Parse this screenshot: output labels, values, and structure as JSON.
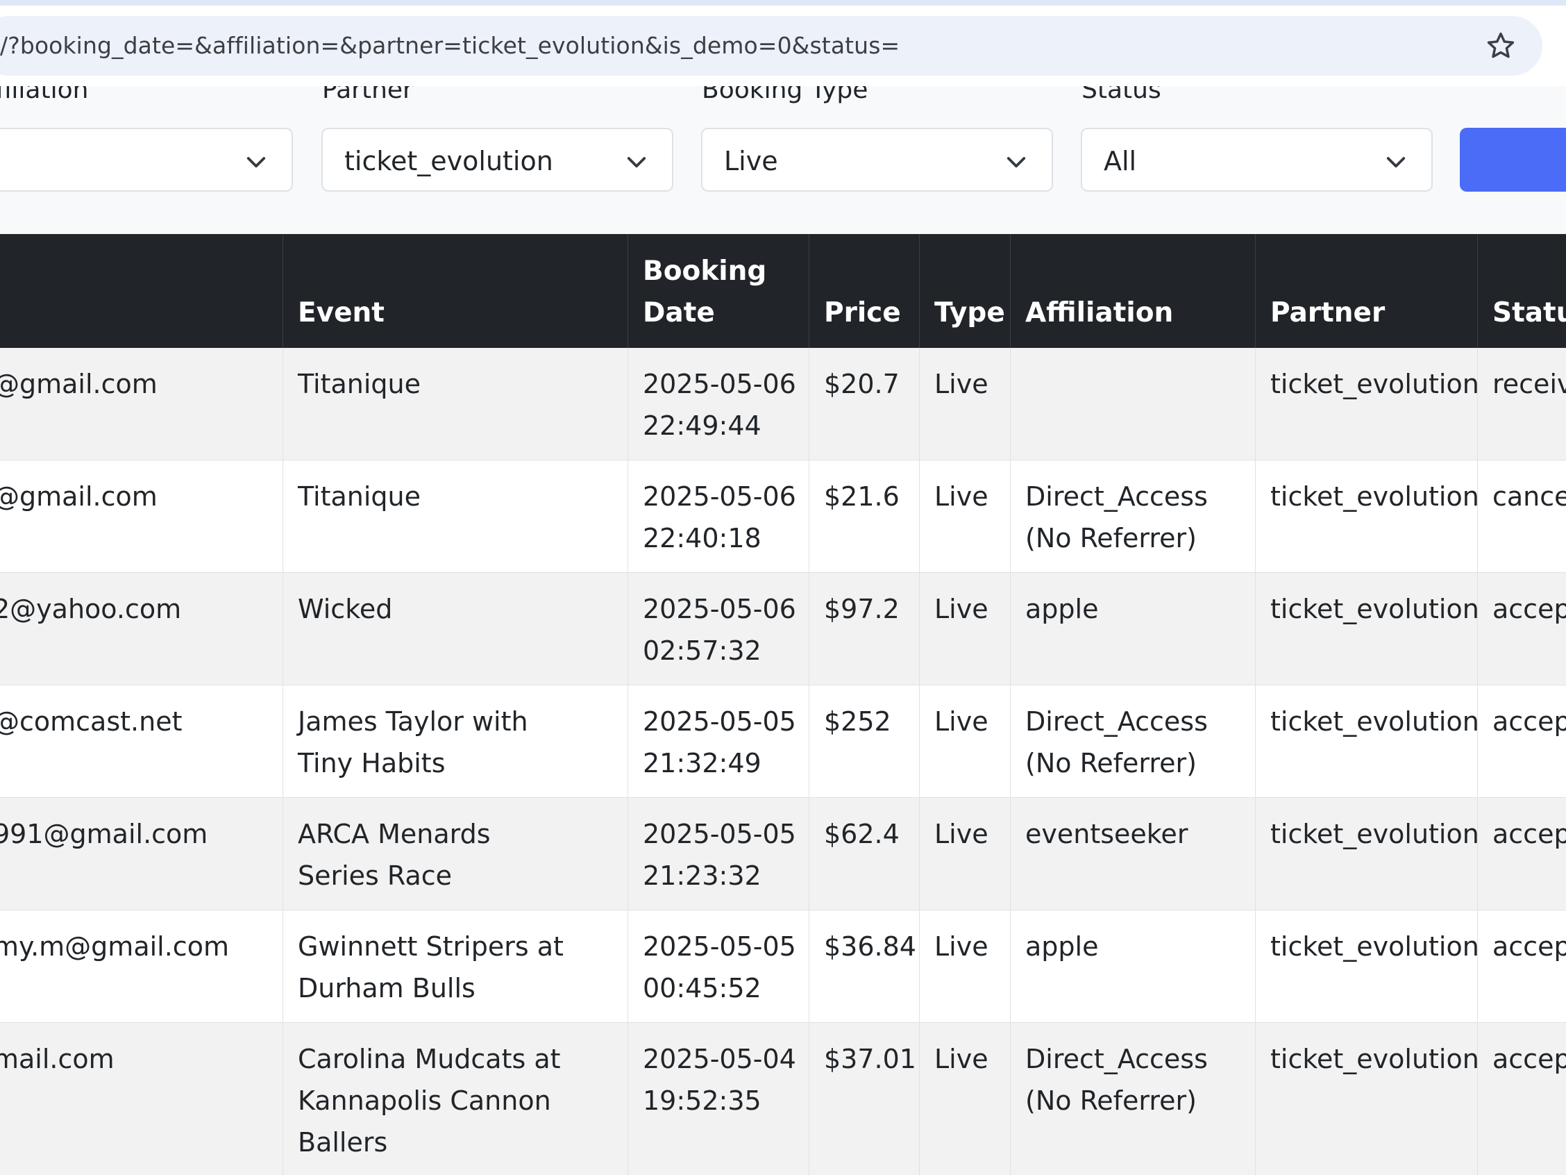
{
  "browser": {
    "url": "/?booking_date=&affiliation=&partner=ticket_evolution&is_demo=0&status="
  },
  "filters": {
    "affiliation_label": "Affiliation",
    "affiliation_value": "",
    "partner_label": "Partner",
    "partner_value": "ticket_evolution",
    "booking_type_label": "Booking Type",
    "booking_type_value": "Live",
    "status_label": "Status",
    "status_value": "All"
  },
  "table": {
    "headers": {
      "email": "",
      "event": "Event",
      "booking_date": "Booking Date",
      "price": "Price",
      "type": "Type",
      "affiliation": "Affiliation",
      "partner": "Partner",
      "status": "Status"
    },
    "rows": [
      {
        "email": "@gmail.com",
        "event": "Titanique",
        "date": "2025-05-06",
        "time": "22:49:44",
        "price": "$20.7",
        "type": "Live",
        "affiliation": "",
        "partner": "ticket_evolution",
        "status": "received"
      },
      {
        "email": "@gmail.com",
        "event": "Titanique",
        "date": "2025-05-06",
        "time": "22:40:18",
        "price": "$21.6",
        "type": "Live",
        "affiliation": "Direct_Access (No Referrer)",
        "partner": "ticket_evolution",
        "status": "cancelled"
      },
      {
        "email": "2@yahoo.com",
        "event": "Wicked",
        "date": "2025-05-06",
        "time": "02:57:32",
        "price": "$97.2",
        "type": "Live",
        "affiliation": "apple",
        "partner": "ticket_evolution",
        "status": "accepted"
      },
      {
        "email": "@comcast.net",
        "event": "James Taylor with Tiny Habits",
        "date": "2025-05-05",
        "time": "21:32:49",
        "price": "$252",
        "type": "Live",
        "affiliation": "Direct_Access (No Referrer)",
        "partner": "ticket_evolution",
        "status": "accepted"
      },
      {
        "email": "991@gmail.com",
        "event": "ARCA Menards Series Race",
        "date": "2025-05-05",
        "time": "21:23:32",
        "price": "$62.4",
        "type": "Live",
        "affiliation": "eventseeker",
        "partner": "ticket_evolution",
        "status": "accepted"
      },
      {
        "email": "my.m@gmail.com",
        "event": "Gwinnett Stripers at Durham Bulls",
        "date": "2025-05-05",
        "time": "00:45:52",
        "price": "$36.84",
        "type": "Live",
        "affiliation": "apple",
        "partner": "ticket_evolution",
        "status": "accepted"
      },
      {
        "email": "mail.com",
        "event": "Carolina Mudcats at Kannapolis Cannon Ballers",
        "date": "2025-05-04",
        "time": "19:52:35",
        "price": "$37.01",
        "type": "Live",
        "affiliation": "Direct_Access (No Referrer)",
        "partner": "ticket_evolution",
        "status": "accepted"
      }
    ]
  }
}
